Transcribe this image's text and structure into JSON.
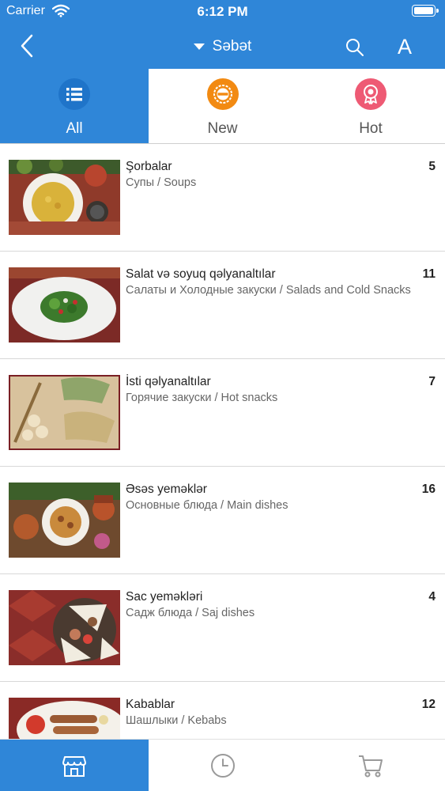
{
  "status_bar": {
    "carrier": "Carrier",
    "time": "6:12 PM"
  },
  "nav": {
    "title": "Səbət",
    "font_button": "A"
  },
  "tabs": [
    {
      "label": "All",
      "icon": "list-icon",
      "color": "#1f74c9",
      "active": true
    },
    {
      "label": "New",
      "icon": "new-badge-icon",
      "color": "#f28a12",
      "active": false
    },
    {
      "label": "Hot",
      "icon": "award-icon",
      "color": "#ee5a74",
      "active": false
    }
  ],
  "categories": [
    {
      "title": "Şorbalar",
      "subtitle": "Супы / Soups",
      "count": "5"
    },
    {
      "title": "Salat və soyuq qəlyanaltılar",
      "subtitle": "Салаты и Холодные закуски / Salads and Cold Snacks",
      "count": "11"
    },
    {
      "title": "İsti qəlyanaltılar",
      "subtitle": "Горячие закуски / Hot snacks",
      "count": "7"
    },
    {
      "title": "Əsəs yeməklər",
      "subtitle": "Основные блюда / Main dishes",
      "count": "16"
    },
    {
      "title": "Sac yeməkləri",
      "subtitle": "Садж блюда / Saj dishes",
      "count": "4"
    },
    {
      "title": "Kabablar",
      "subtitle": "Шашлыки / Kebabs",
      "count": "12"
    }
  ],
  "bottom_nav": [
    {
      "icon": "store-icon",
      "active": true
    },
    {
      "icon": "clock-icon",
      "active": false
    },
    {
      "icon": "cart-icon",
      "active": false
    }
  ],
  "colors": {
    "primary": "#2f86d8",
    "new": "#f28a12",
    "hot": "#ee5a74"
  }
}
